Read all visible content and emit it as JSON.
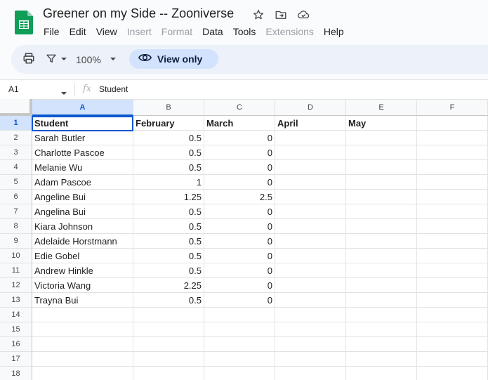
{
  "document": {
    "title": "Greener on my Side -- Zooniverse"
  },
  "menu": [
    {
      "label": "File",
      "disabled": false
    },
    {
      "label": "Edit",
      "disabled": false
    },
    {
      "label": "View",
      "disabled": false
    },
    {
      "label": "Insert",
      "disabled": true
    },
    {
      "label": "Format",
      "disabled": true
    },
    {
      "label": "Data",
      "disabled": false
    },
    {
      "label": "Tools",
      "disabled": false
    },
    {
      "label": "Extensions",
      "disabled": true
    },
    {
      "label": "Help",
      "disabled": false
    }
  ],
  "toolbar": {
    "zoom": "100%",
    "view_only_label": "View only"
  },
  "formula_bar": {
    "cell_ref": "A1",
    "fx_label": "fx",
    "content": "Student"
  },
  "colors": {
    "accent": "#0b57d0",
    "sheets_green": "#0f9d58",
    "selected_header": "#d3e3fd",
    "toolbar_bg": "#edf2fa"
  },
  "grid": {
    "columns": [
      "A",
      "B",
      "C",
      "D",
      "E",
      "F"
    ],
    "row_numbers": [
      "1",
      "2",
      "3",
      "4",
      "5",
      "6",
      "7",
      "8",
      "9",
      "10",
      "11",
      "12",
      "13",
      "14",
      "15",
      "16",
      "17",
      "18"
    ],
    "rows": [
      [
        "Student",
        "February",
        "March",
        "April",
        "May",
        ""
      ],
      [
        "Sarah Butler",
        "0.5",
        "0",
        "",
        "",
        ""
      ],
      [
        "Charlotte Pascoe",
        "0.5",
        "0",
        "",
        "",
        ""
      ],
      [
        "Melanie Wu",
        "0.5",
        "0",
        "",
        "",
        ""
      ],
      [
        "Adam Pascoe",
        "1",
        "0",
        "",
        "",
        ""
      ],
      [
        "Angeline Bui",
        "1.25",
        "2.5",
        "",
        "",
        ""
      ],
      [
        "Angelina Bui",
        "0.5",
        "0",
        "",
        "",
        ""
      ],
      [
        "Kiara Johnson",
        "0.5",
        "0",
        "",
        "",
        ""
      ],
      [
        "Adelaide Horstmann",
        "0.5",
        "0",
        "",
        "",
        ""
      ],
      [
        "Edie Gobel",
        "0.5",
        "0",
        "",
        "",
        ""
      ],
      [
        "Andrew Hinkle",
        "0.5",
        "0",
        "",
        "",
        ""
      ],
      [
        "Victoria Wang",
        "2.25",
        "0",
        "",
        "",
        ""
      ],
      [
        "Trayna Bui",
        "0.5",
        "0",
        "",
        "",
        ""
      ],
      [
        "",
        "",
        "",
        "",
        "",
        ""
      ],
      [
        "",
        "",
        "",
        "",
        "",
        ""
      ],
      [
        "",
        "",
        "",
        "",
        "",
        ""
      ],
      [
        "",
        "",
        "",
        "",
        "",
        ""
      ],
      [
        "",
        "",
        "",
        "",
        "",
        ""
      ]
    ]
  }
}
